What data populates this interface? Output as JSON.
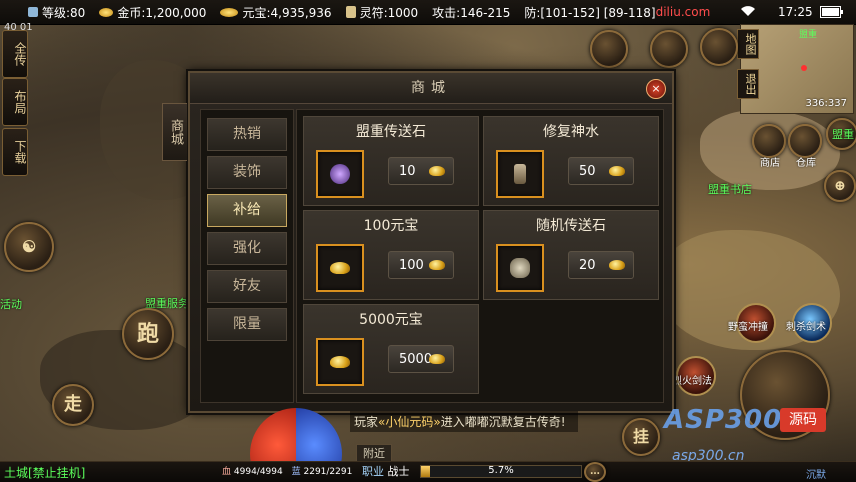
{
  "status_bar": {
    "level": "等级:80",
    "gold": "金币:1,200,000",
    "yuanbao": "元宝:4,935,936",
    "lingfu": "灵符:1000",
    "attack": "攻击:146-215",
    "defense": "防:[101-152] [89-118]",
    "watermark": "diliu.com",
    "time": "17:25",
    "top_left_text": "40 01"
  },
  "left_buttons": [
    "全传",
    "布局",
    "下载"
  ],
  "round_buttons": {
    "run": "跑",
    "walk": "走",
    "hang": "挂"
  },
  "minimap": {
    "label_map": "地图",
    "label_return": "退出",
    "coords": "336:337",
    "place_label": "盟重"
  },
  "dialog": {
    "title": "商城",
    "close": "×",
    "side_tab": "商城",
    "categories": [
      {
        "label": "热销",
        "active": false
      },
      {
        "label": "装饰",
        "active": false
      },
      {
        "label": "补给",
        "active": true
      },
      {
        "label": "强化",
        "active": false
      },
      {
        "label": "好友",
        "active": false
      },
      {
        "label": "限量",
        "active": false
      }
    ],
    "items": [
      {
        "name": "盟重传送石",
        "price": "10"
      },
      {
        "name": "修复神水",
        "price": "50"
      },
      {
        "name": "100元宝",
        "price": "100"
      },
      {
        "name": "随机传送石",
        "price": "20"
      },
      {
        "name": "5000元宝",
        "price": "5000"
      }
    ]
  },
  "world_labels": {
    "npc_shop": "盟重书店",
    "npc_left": "盟重服务",
    "activity": "活动",
    "place_top": "盟重",
    "npc_a": "商店",
    "npc_b": "仓库"
  },
  "skills": [
    {
      "label": "野蛮冲撞"
    },
    {
      "label": "刺杀剑术"
    },
    {
      "label": "烈火剑法"
    }
  ],
  "chat": {
    "prefix": "玩家",
    "name": "«小仙元码»",
    "message": "进入嘟嘟沉默复古传奇!",
    "tab": "附近"
  },
  "bottom": {
    "location": "土城[禁止挂机]",
    "hp": "4994/4994",
    "mp": "2291/2291",
    "career_label": "职业",
    "career": "战士",
    "xp_percent": "5.7%",
    "xp_fraction": 0.057
  },
  "branding": {
    "logo": "ASP300",
    "tag": "源码",
    "sub": "asp300.cn",
    "corner": "沉默"
  }
}
